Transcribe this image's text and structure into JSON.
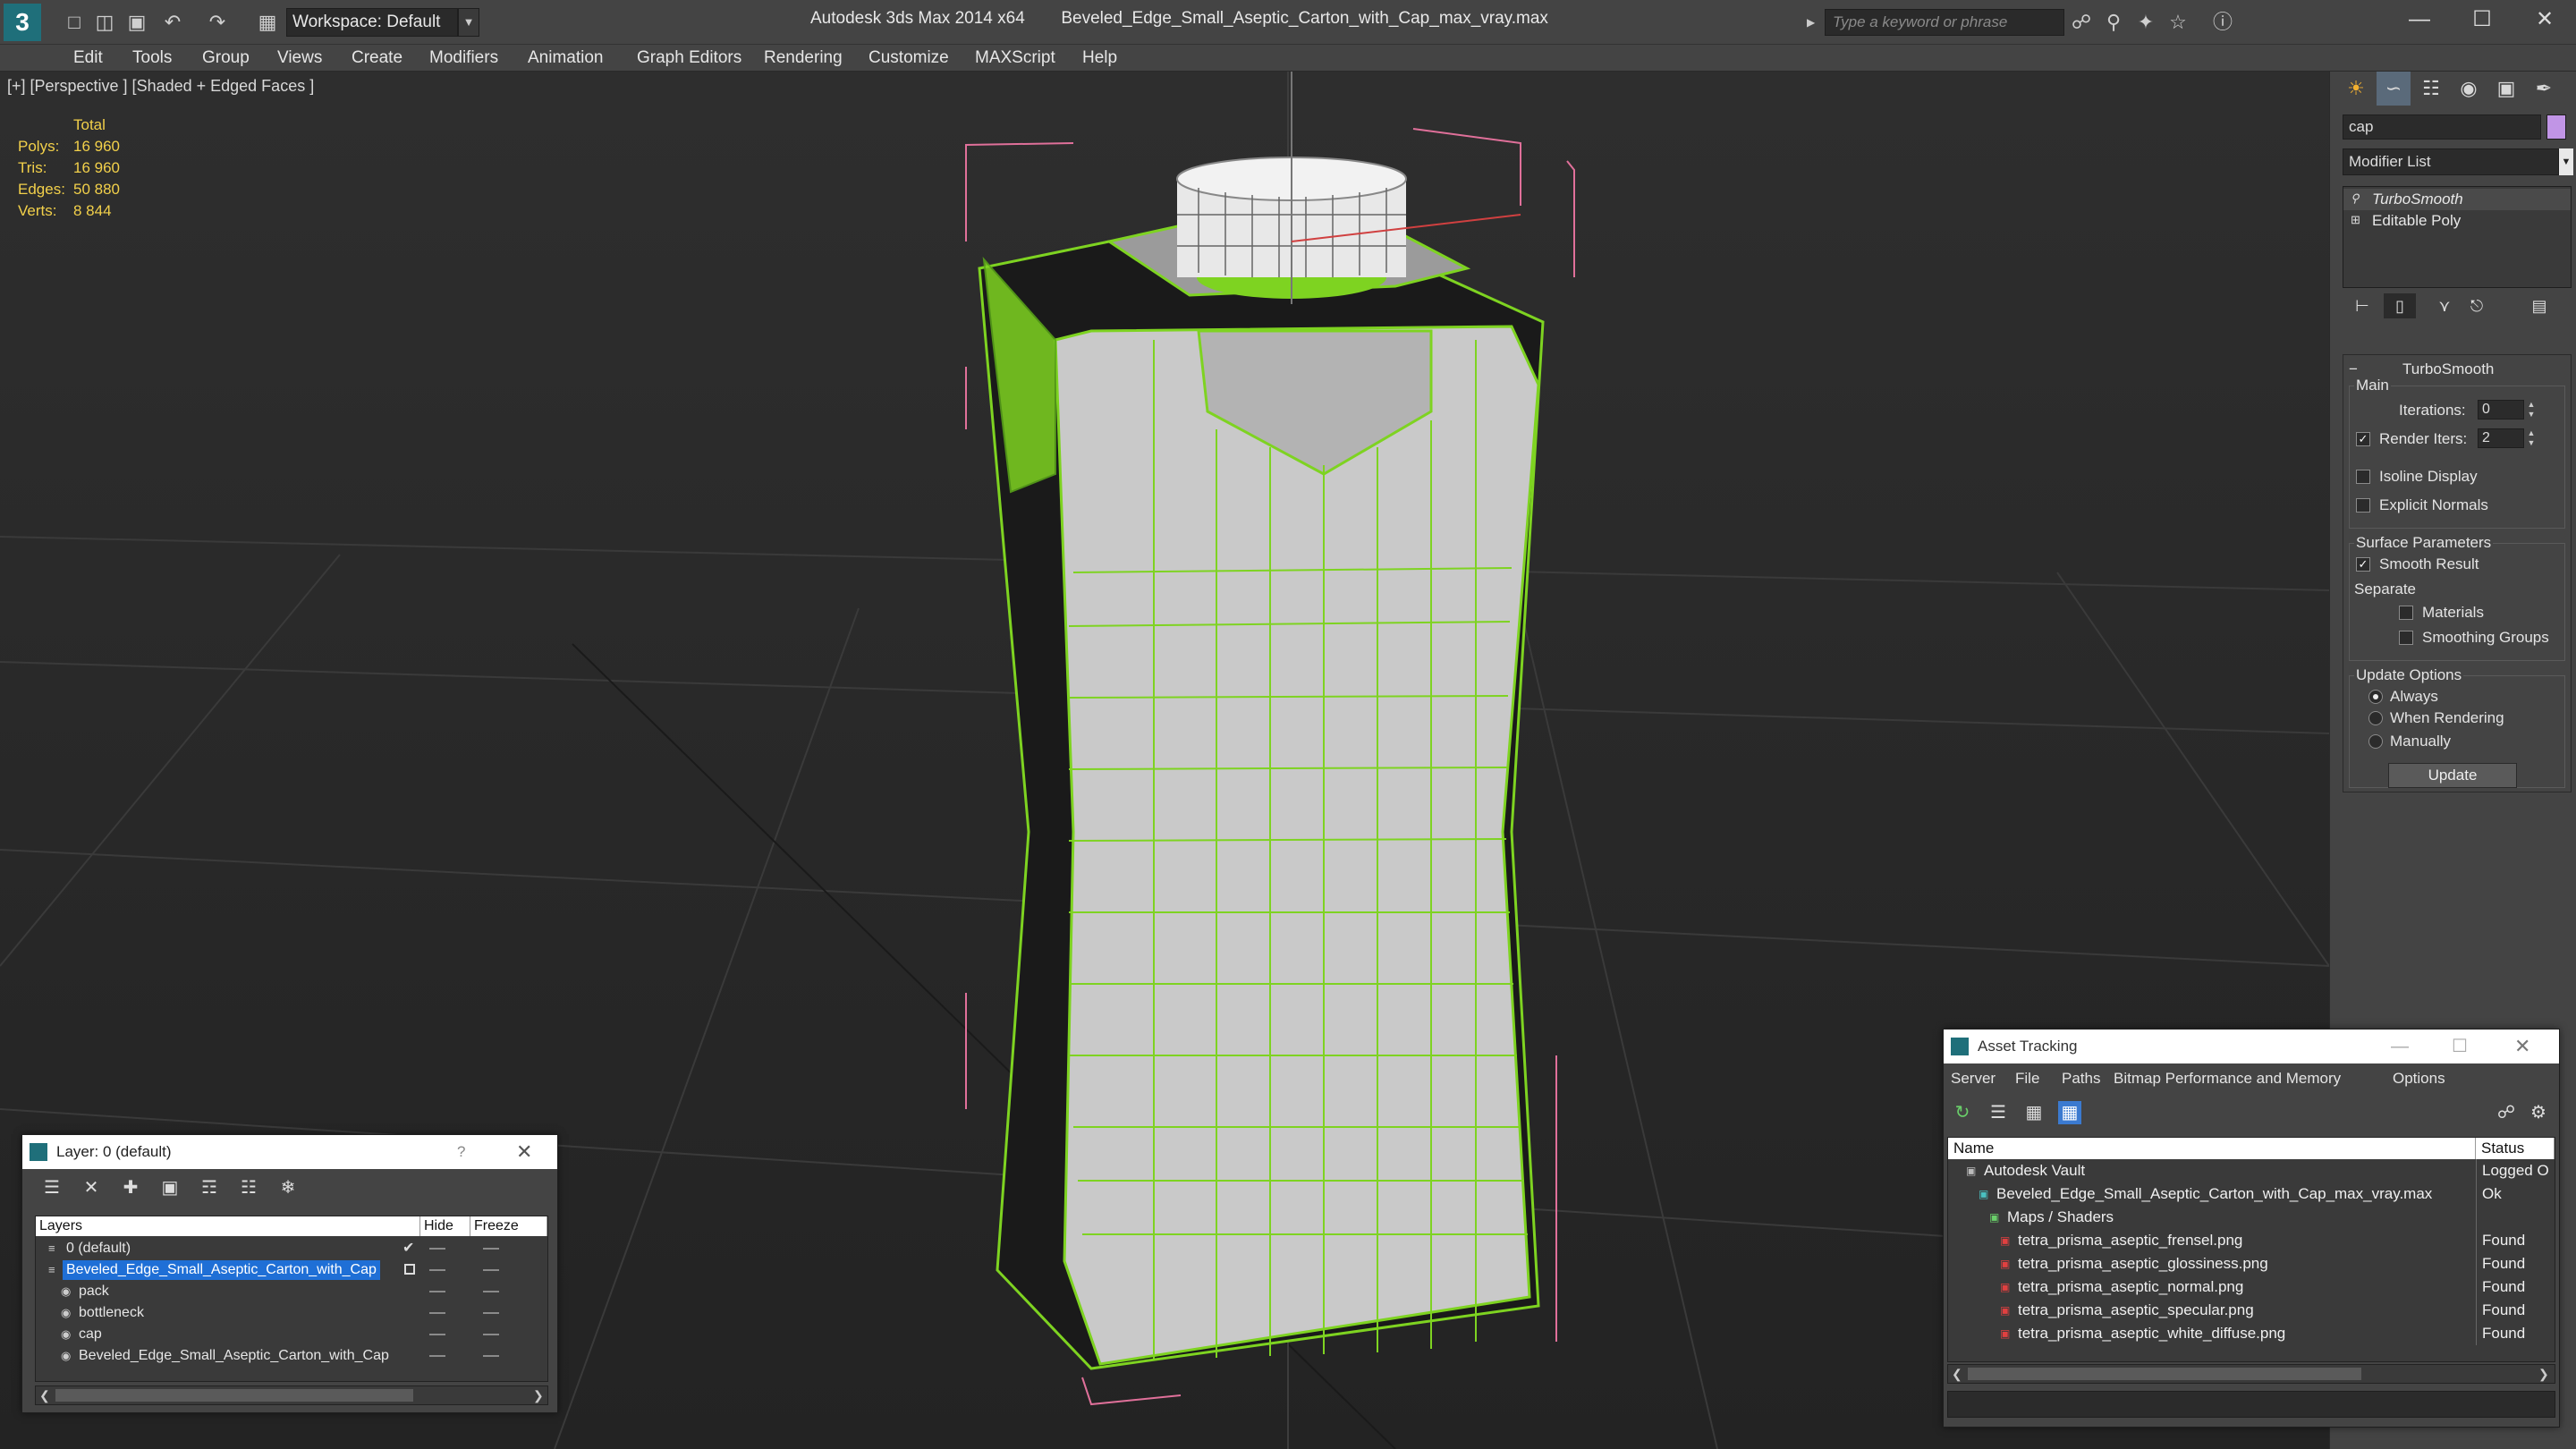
{
  "titlebar": {
    "app_title": "Autodesk 3ds Max 2014 x64",
    "file_title": "Beveled_Edge_Small_Aseptic_Carton_with_Cap_max_vray.max",
    "workspace_label": "Workspace: Default",
    "search_placeholder": "Type a keyword or phrase"
  },
  "menu": [
    "Edit",
    "Tools",
    "Group",
    "Views",
    "Create",
    "Modifiers",
    "Animation",
    "Graph Editors",
    "Rendering",
    "Customize",
    "MAXScript",
    "Help"
  ],
  "viewport": {
    "label": "[+] [Perspective ] [Shaded + Edged Faces ]",
    "stats": {
      "header": "Total",
      "rows": [
        {
          "label": "Polys:",
          "value": "16 960"
        },
        {
          "label": "Tris:",
          "value": "16 960"
        },
        {
          "label": "Edges:",
          "value": "50 880"
        },
        {
          "label": "Verts:",
          "value": "8 844"
        }
      ]
    }
  },
  "command_panel": {
    "object_name": "cap",
    "modifier_list": "Modifier List",
    "stack": [
      "TurboSmooth",
      "Editable Poly"
    ],
    "rollout": {
      "title": "TurboSmooth",
      "main_label": "Main",
      "iterations_label": "Iterations:",
      "iterations_value": "0",
      "render_iters_label": "Render Iters:",
      "render_iters_value": "2",
      "isoline_label": "Isoline Display",
      "explicit_label": "Explicit Normals",
      "surface_label": "Surface Parameters",
      "smooth_label": "Smooth Result",
      "separate_label": "Separate",
      "materials_label": "Materials",
      "smoothing_label": "Smoothing Groups",
      "update_options_label": "Update Options",
      "always_label": "Always",
      "when_rendering_label": "When Rendering",
      "manually_label": "Manually",
      "update_button": "Update"
    }
  },
  "layer_panel": {
    "title": "Layer: 0 (default)",
    "help": "?",
    "columns": [
      "Layers",
      "Hide",
      "Freeze"
    ],
    "rows": [
      {
        "name": "0 (default)",
        "indent": 1,
        "selected": false,
        "active": true
      },
      {
        "name": "Beveled_Edge_Small_Aseptic_Carton_with_Cap",
        "indent": 1,
        "selected": true,
        "active": false
      },
      {
        "name": "pack",
        "indent": 2,
        "selected": false,
        "active": false
      },
      {
        "name": "bottleneck",
        "indent": 2,
        "selected": false,
        "active": false
      },
      {
        "name": "cap",
        "indent": 2,
        "selected": false,
        "active": false
      },
      {
        "name": "Beveled_Edge_Small_Aseptic_Carton_with_Cap",
        "indent": 2,
        "selected": false,
        "active": false
      }
    ]
  },
  "asset_panel": {
    "title": "Asset Tracking",
    "menu": [
      "Server",
      "File",
      "Paths",
      "Bitmap Performance and Memory",
      "Options"
    ],
    "columns": [
      "Name",
      "Status"
    ],
    "rows": [
      {
        "name": "Autodesk Vault",
        "indent": 1,
        "status": "Logged O"
      },
      {
        "name": "Beveled_Edge_Small_Aseptic_Carton_with_Cap_max_vray.max",
        "indent": 2,
        "status": "Ok"
      },
      {
        "name": "Maps / Shaders",
        "indent": 3,
        "status": ""
      },
      {
        "name": "tetra_prisma_aseptic_frensel.png",
        "indent": 4,
        "status": "Found"
      },
      {
        "name": "tetra_prisma_aseptic_glossiness.png",
        "indent": 4,
        "status": "Found"
      },
      {
        "name": "tetra_prisma_aseptic_normal.png",
        "indent": 4,
        "status": "Found"
      },
      {
        "name": "tetra_prisma_aseptic_specular.png",
        "indent": 4,
        "status": "Found"
      },
      {
        "name": "tetra_prisma_aseptic_white_diffuse.png",
        "indent": 4,
        "status": "Found"
      }
    ]
  },
  "colors": {
    "wire_green": "#7ed321",
    "selection_blue": "#1f6fd6",
    "stat_yellow": "#f2d04a",
    "bbox_pink": "#e0709a",
    "swatch": "#c195e6"
  }
}
